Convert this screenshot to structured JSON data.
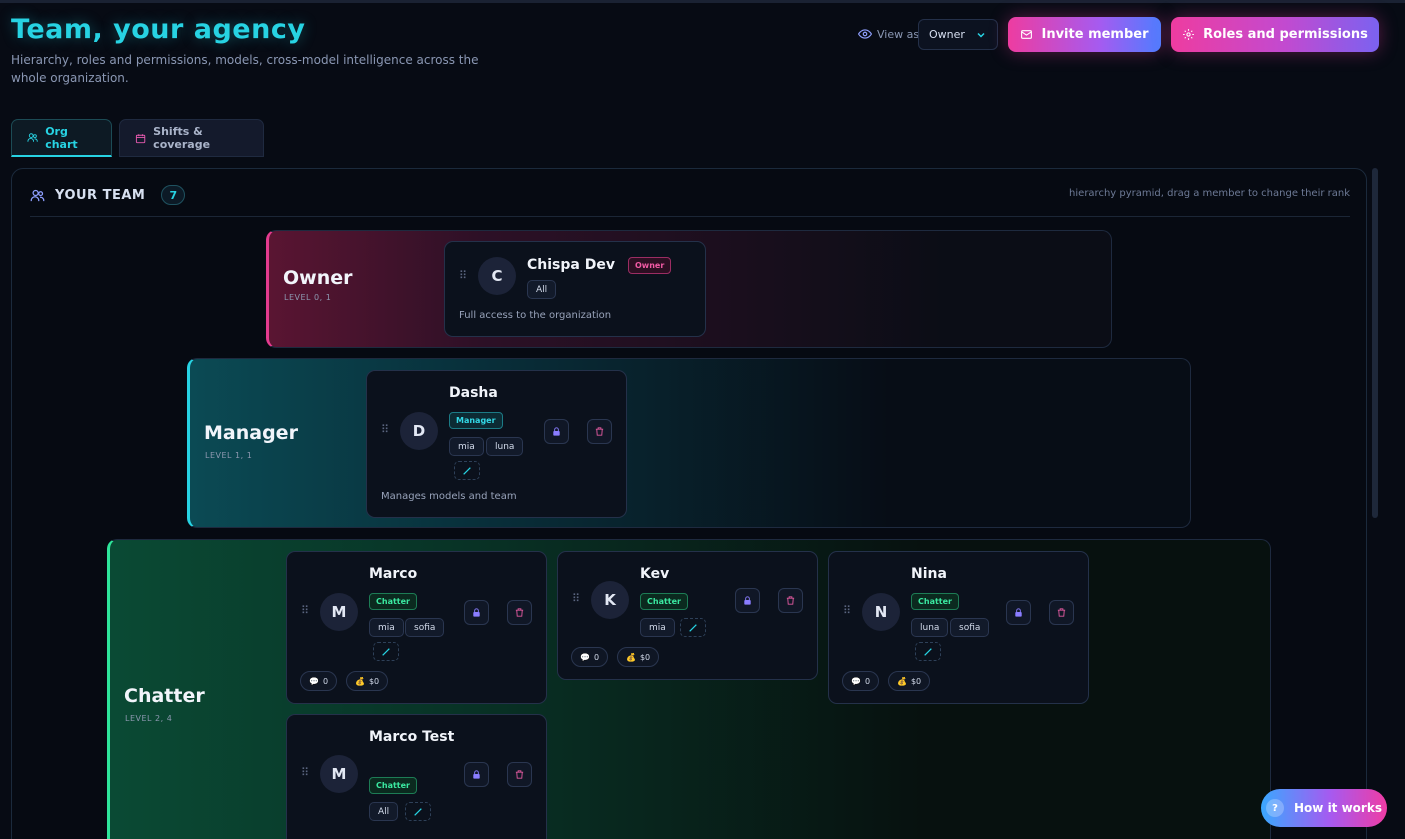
{
  "header": {
    "title": "Team, your agency",
    "subtitle": "Hierarchy, roles and permissions, models, cross-model intelligence across the whole organization.",
    "view_as_label": "View as",
    "view_as_value": "Owner",
    "invite_label": "Invite member",
    "roles_label": "Roles and permissions"
  },
  "tabs": [
    {
      "label": "Org chart",
      "active": true
    },
    {
      "label": "Shifts & coverage",
      "active": false
    }
  ],
  "team": {
    "title": "YOUR TEAM",
    "count": "7",
    "hint": "hierarchy pyramid, drag a member to change their rank"
  },
  "levels": {
    "owner": {
      "name": "Owner",
      "level": "LEVEL 0, 1",
      "members": [
        {
          "initial": "C",
          "name": "Chispa Dev",
          "role": "Owner",
          "models": [
            "All"
          ],
          "description": "Full access to the organization"
        }
      ]
    },
    "manager": {
      "name": "Manager",
      "level": "LEVEL 1, 1",
      "members": [
        {
          "initial": "D",
          "name": "Dasha",
          "role": "Manager",
          "models": [
            "mia",
            "luna"
          ],
          "description": "Manages models and team"
        }
      ]
    },
    "chatter": {
      "name": "Chatter",
      "level": "LEVEL 2, 4",
      "members": [
        {
          "initial": "M",
          "name": "Marco",
          "role": "Chatter",
          "models": [
            "mia",
            "sofia"
          ],
          "messages": "0",
          "revenue": "$0"
        },
        {
          "initial": "K",
          "name": "Kev",
          "role": "Chatter",
          "models": [
            "mia"
          ],
          "messages": "0",
          "revenue": "$0"
        },
        {
          "initial": "N",
          "name": "Nina",
          "role": "Chatter",
          "models": [
            "luna",
            "sofia"
          ],
          "messages": "0",
          "revenue": "$0"
        },
        {
          "initial": "M",
          "name": "Marco Test",
          "role": "Chatter",
          "models": [
            "All"
          ]
        }
      ]
    }
  },
  "help": {
    "label": "How it works",
    "glyph": "?"
  },
  "icons": {
    "grip": "⠿",
    "messages": "💬",
    "revenue": "💰"
  },
  "colors": {
    "accent_cyan": "#27d3e3",
    "owner_pink": "#e43b8f",
    "chatter_green": "#2ee69b",
    "background": "#070b14"
  }
}
